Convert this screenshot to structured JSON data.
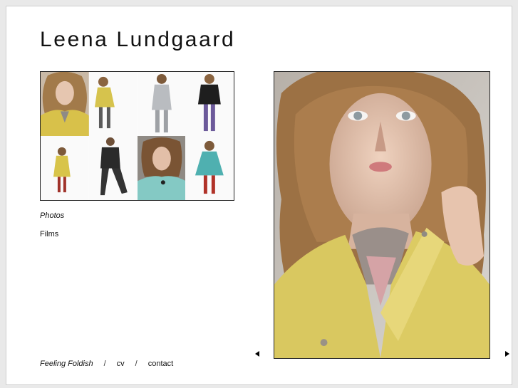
{
  "site": {
    "title": "Leena Lundgaard"
  },
  "nav": {
    "photos_label": "Photos",
    "films_label": "Films"
  },
  "footer": {
    "collection_label": "Feeling Foldish",
    "separator": "/",
    "cv_label": "cv",
    "contact_label": "contact"
  },
  "gallery": {
    "thumbnails": [
      "portrait-yellow-coat",
      "model-yellow-top-leaning",
      "model-grey-dress-front",
      "model-black-jacket-purple-tights",
      "model-yellow-dress-small",
      "model-black-outfit-striding",
      "portrait-teal-top",
      "model-teal-ruffle-dress"
    ],
    "icons": {
      "prev": "arrow-left-icon",
      "next": "arrow-right-icon"
    }
  }
}
